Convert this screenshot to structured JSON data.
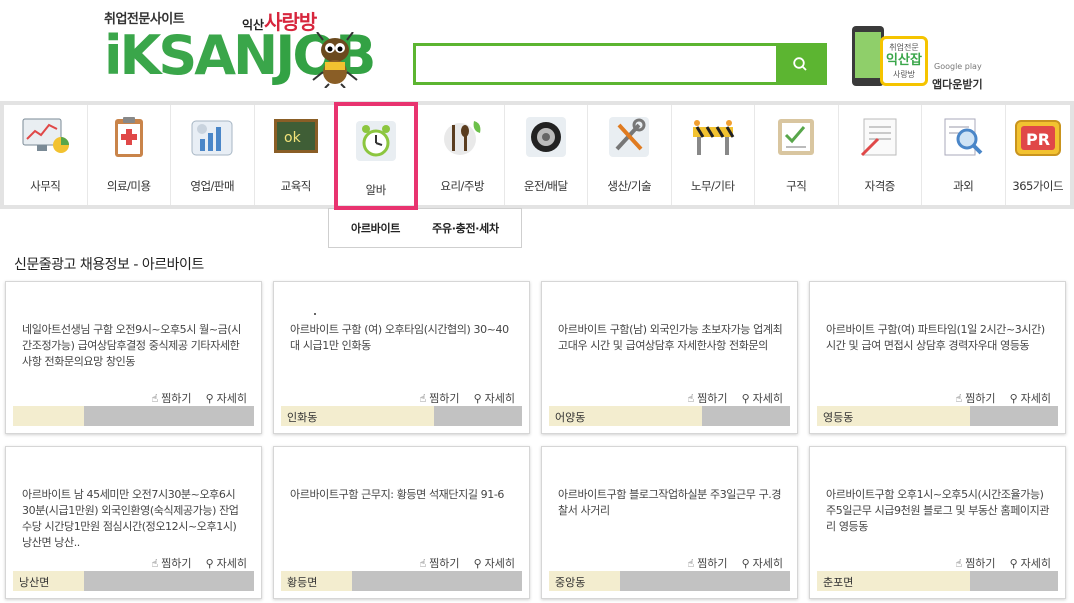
{
  "header": {
    "tagline": "취업전문사이트",
    "brand_prefix": "익산",
    "brand_name": "사랑방",
    "logo_left": "iKSAN",
    "logo_right": "JOB",
    "search_placeholder": "",
    "app": {
      "badge_top": "취업전문",
      "badge_main": "익산잡",
      "badge_sub": "사랑방",
      "store": "Google play",
      "download_label": "앱다운받기"
    }
  },
  "categories": [
    {
      "label": "사무직",
      "icon": "monitor-chart-icon"
    },
    {
      "label": "의료/미용",
      "icon": "clipboard-medical-icon"
    },
    {
      "label": "영업/판매",
      "icon": "sales-graph-icon"
    },
    {
      "label": "교육직",
      "icon": "chalkboard-icon"
    },
    {
      "label": "알바",
      "icon": "alarm-clock-icon"
    },
    {
      "label": "요리/주방",
      "icon": "fork-spoon-icon"
    },
    {
      "label": "운전/배달",
      "icon": "tire-icon"
    },
    {
      "label": "생산/기술",
      "icon": "tools-icon"
    },
    {
      "label": "노무/기타",
      "icon": "barrier-icon"
    },
    {
      "label": "구직",
      "icon": "checklist-icon"
    },
    {
      "label": "자격증",
      "icon": "certificate-icon"
    },
    {
      "label": "과외",
      "icon": "magnifier-document-icon"
    },
    {
      "label": "365가이드",
      "icon": "pr-tv-icon"
    }
  ],
  "active_category": "알바",
  "submenu": [
    "아르바이트",
    "주유·충전·세차"
  ],
  "section_title": "신문줄광고 채용정보 - 아르바이트",
  "actions": {
    "save": "찜하기",
    "detail": "자세히"
  },
  "cards": [
    {
      "desc": "네일아트선생님 구함 오전9시~오후5시 월~금(시간조정가능) 급여상담후결정 중식제공 기타자세한사항 전화문의요망 창인동",
      "location": ""
    },
    {
      "desc": "아르바이트 구함 (여) 오후타임(시간협의) 30~40대 시급1만 인화동",
      "location": "인화동"
    },
    {
      "desc": "아르바이트 구함(남) 외국인가능 초보자가능 업계최고대우 시간 및 급여상담후 자세한사항 전화문의",
      "location": "어양동"
    },
    {
      "desc": "아르바이트 구함(여) 파트타임(1일 2시간~3시간) 시간 및 급여 면접시 상담후 경력자우대 영등동",
      "location": "영등동"
    },
    {
      "desc": "아르바이트 남 45세미만 오전7시30분~오후6시30분(시급1만원) 외국인환영(숙식제공가능) 잔업수당 시간당1만원 점심시간(정오12시~오후1시) 낭산면 낭산..",
      "location": "낭산면"
    },
    {
      "desc": "아르바이트구함 근무지: 황등면 석재단지길 91-6",
      "location": "황등면"
    },
    {
      "desc": "아르바이트구함 블로그작업하실분 주3일근무 구.경찰서 사거리",
      "location": "중앙동"
    },
    {
      "desc": "아르바이트구함 오후1시~오후5시(시간조율가능) 주5일근무 시급9천원 블로그 및 부동산 홈페이지관리 영등동",
      "location": "춘포면"
    }
  ],
  "colors": {
    "brand_green": "#5cb531",
    "active_border": "#e8336f",
    "card_footer": "#f3edcf"
  }
}
